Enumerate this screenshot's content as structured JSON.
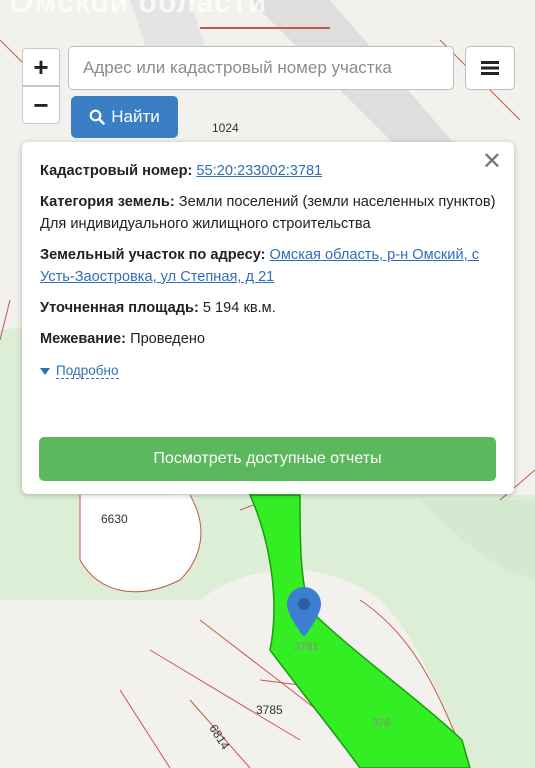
{
  "header": {
    "title_partial": "Омской области"
  },
  "toolbar": {
    "zoom_in_label": "+",
    "zoom_out_label": "−",
    "search_placeholder": "Адрес или кадастровый номер участка",
    "find_label": "Найти"
  },
  "map": {
    "labels": {
      "parcel_1024": "1024",
      "parcel_6630": "6630",
      "parcel_3781": "3781",
      "parcel_3785": "3785",
      "parcel_6814": "6814",
      "parcel_378": "378"
    }
  },
  "popup": {
    "cadastral_label": "Кадастровый номер:",
    "cadastral_value": "55:20:233002:3781",
    "category_label": "Категория земель:",
    "category_value": "Земли поселений (земли населенных пунктов)",
    "usage": "Для индивидуального жилищного строительства",
    "address_label": "Земельный участок по адресу:",
    "address_value": "Омская область, р-н Омский, с Усть-Заостровка, ул Степная, д 21",
    "area_label": "Уточненная площадь:",
    "area_value": "5 194 кв.м.",
    "survey_label": "Межевание:",
    "survey_value": "Проведено",
    "more_label": "Подробно",
    "reports_button": "Посмотреть доступные отчеты"
  },
  "colors": {
    "primary_blue": "#3a7fc4",
    "success_green": "#5cb85c",
    "parcel_fill": "#33ee22",
    "marker_blue": "#3d7ed1"
  },
  "icons": {
    "search": "search-icon",
    "menu": "hamburger-menu-icon",
    "close": "close-icon",
    "caret": "caret-down-icon",
    "marker": "map-pin-icon"
  }
}
